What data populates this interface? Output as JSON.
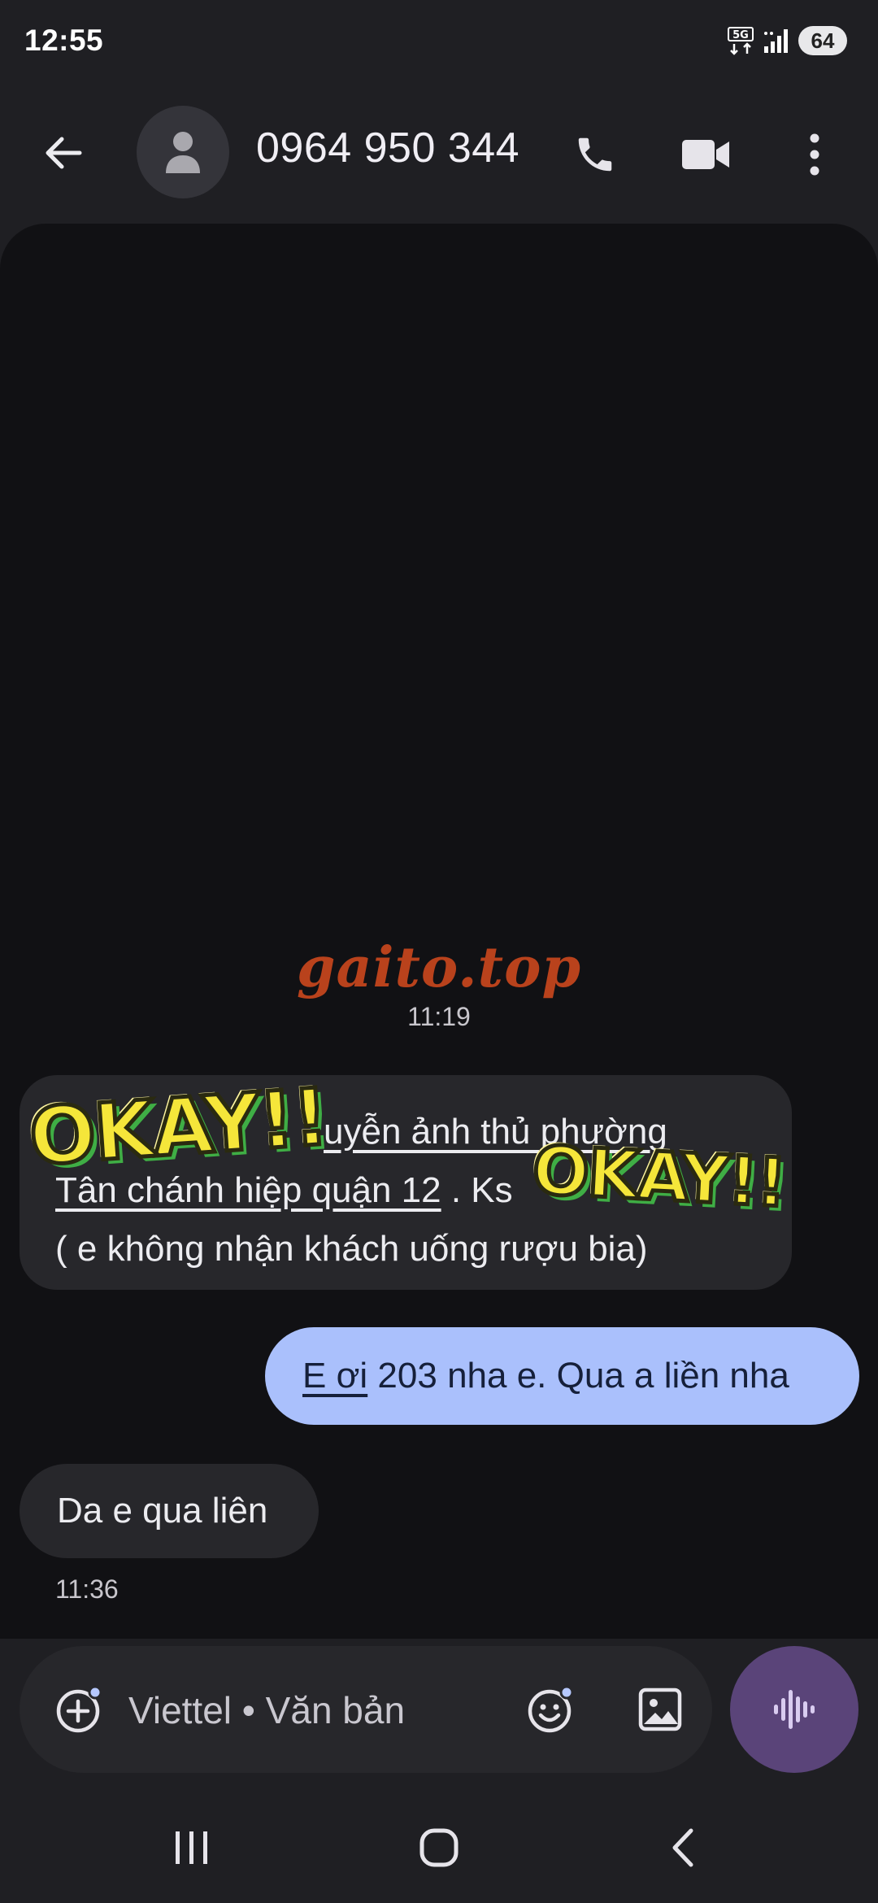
{
  "status_bar": {
    "time": "12:55",
    "network": "5G",
    "battery": "64"
  },
  "header": {
    "contact": "0964 950 344",
    "icons": [
      "back-arrow-icon",
      "person-icon",
      "phone-icon",
      "video-camera-icon",
      "more-vert-icon"
    ]
  },
  "watermark": "gaito.top",
  "messages": [
    {
      "direction": "incoming",
      "time": "11:19",
      "line1_prefix": "",
      "line1_link": "uyễn ảnh thủ phường",
      "line2_link": "Tân chánh hiệp quận 12",
      "line2_suffix": " . Ks",
      "line3": "( e không nhận khách uống rượu bia)",
      "stickers": [
        "OKAY!!",
        "OKAY!!"
      ]
    },
    {
      "direction": "outgoing",
      "link": "E ơi",
      "text": " 203 nha e. Qua a liền nha"
    },
    {
      "direction": "incoming",
      "text": "Da e qua liên",
      "time": "11:36"
    }
  ],
  "compose": {
    "placeholder": "Viettel • Văn bản",
    "value": ""
  },
  "colors": {
    "background": "#1f1f23",
    "conversation_bg": "#111114",
    "incoming_bubble": "#27272b",
    "outgoing_bubble": "#aac0fc",
    "voice_button": "#5a4479",
    "watermark": "#b9421c"
  }
}
